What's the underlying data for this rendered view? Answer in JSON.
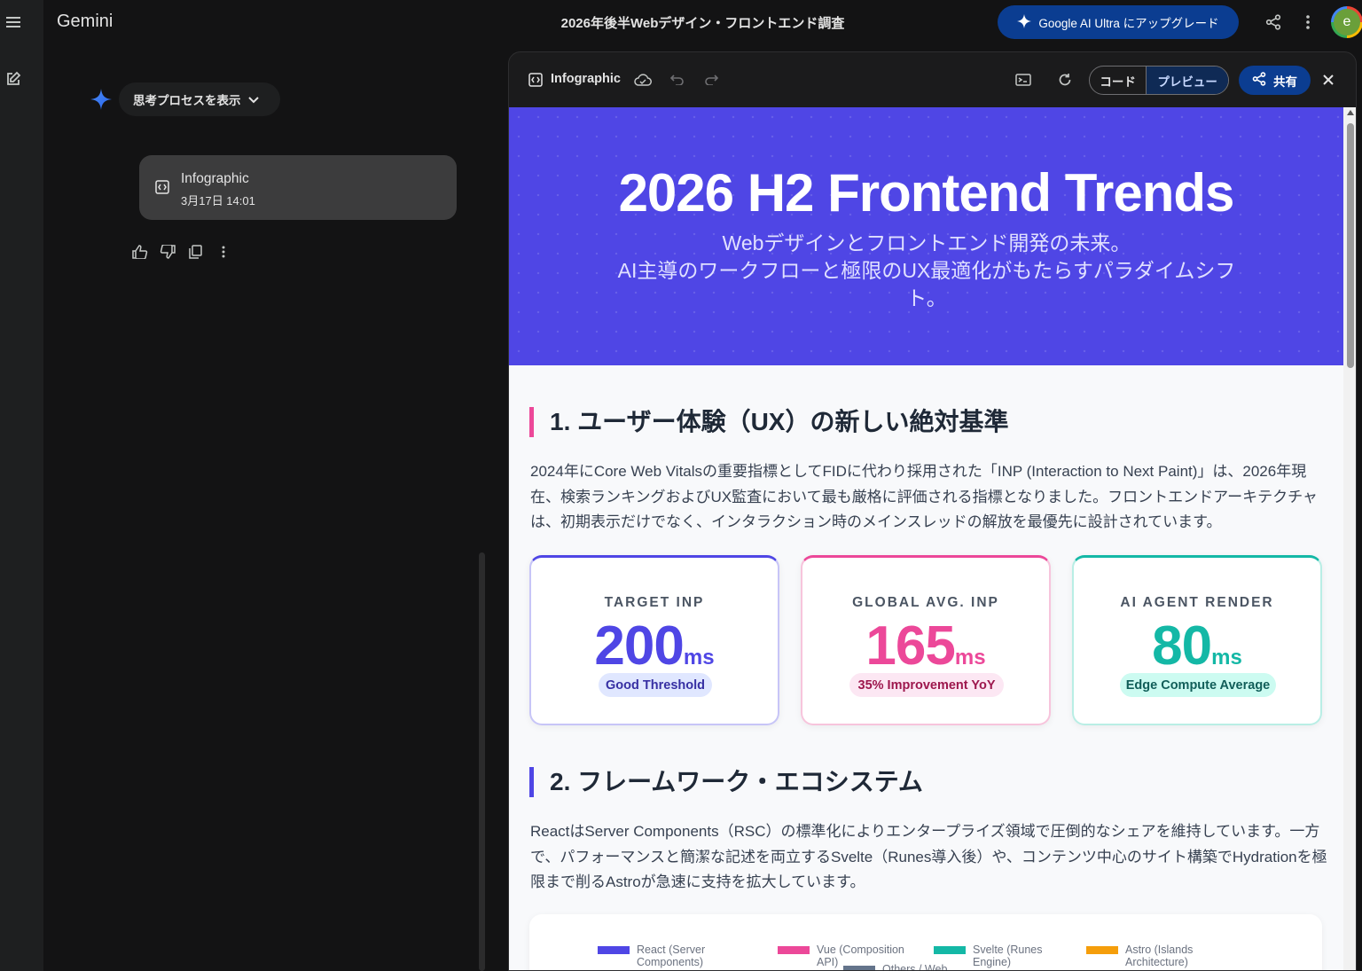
{
  "app": {
    "name": "Gemini",
    "title": "2026年後半Webデザイン・フロントエンド調査",
    "upgrade_label": "Google AI Ultra にアップグレード",
    "avatar_letter": "e"
  },
  "chat": {
    "think_label": "思考プロセスを表示",
    "artifact": {
      "title": "Infographic",
      "timestamp": "3月17日 14:01"
    }
  },
  "panel": {
    "label": "Infographic",
    "code_label": "コード",
    "preview_label": "プレビュー",
    "share_label": "共有"
  },
  "infographic": {
    "title": "2026 H2 Frontend Trends",
    "subtitle_line1": "Webデザインとフロントエンド開発の未来。",
    "subtitle_line2": "AI主導のワークフローと極限のUX最適化がもたらすパラダイムシフト。",
    "section1": {
      "heading": "1. ユーザー体験（UX）の新しい絶対基準",
      "body": "2024年にCore Web Vitalsの重要指標としてFIDに代わり採用された「INP (Interaction to Next Paint)」は、2026年現在、検索ランキングおよびUX監査において最も厳格に評価される指標となりました。フロントエンドアーキテクチャは、初期表示だけでなく、インタラクション時のメインスレッドの解放を最優先に設計されています。"
    },
    "stats": [
      {
        "label": "TARGET INP",
        "value": "200",
        "unit": "ms",
        "note": "Good Threshold",
        "color": "#4f46e5",
        "pill_bg": "#e0e7ff",
        "pill_fg": "#3730a3"
      },
      {
        "label": "GLOBAL AVG. INP",
        "value": "165",
        "unit": "ms",
        "note": "35% Improvement YoY",
        "color": "#ec4899",
        "pill_bg": "#fce7f3",
        "pill_fg": "#9d174d"
      },
      {
        "label": "AI AGENT RENDER",
        "value": "80",
        "unit": "ms",
        "note": "Edge Compute Average",
        "color": "#14b8a6",
        "pill_bg": "#ccfbf1",
        "pill_fg": "#115e59"
      }
    ],
    "section2": {
      "heading": "2. フレームワーク・エコシステム",
      "body": "ReactはServer Components（RSC）の標準化によりエンタープライズ領域で圧倒的なシェアを維持しています。一方で、パフォーマンスと簡潔な記述を両立するSvelte（Runes導入後）や、コンテンツ中心のサイト構築でHydrationを極限まで削るAstroが急速に支持を拡大しています。"
    },
    "legend": [
      {
        "label": "React (Server Components)",
        "color": "#4f46e5"
      },
      {
        "label": "Vue (Composition API)",
        "color": "#ec4899"
      },
      {
        "label": "Svelte (Runes Engine)",
        "color": "#14b8a6"
      },
      {
        "label": "Astro (Islands Architecture)",
        "color": "#f59e0b"
      },
      {
        "label": "Others / Web",
        "color": "#64748b"
      }
    ]
  }
}
